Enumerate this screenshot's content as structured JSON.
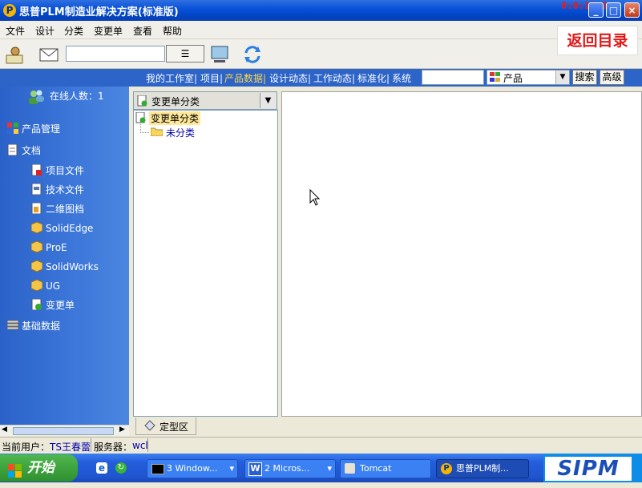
{
  "window": {
    "title": "思普PLM制造业解决方案(标准版)",
    "clock": "0:0:11:0",
    "controls": [
      "_",
      "□",
      "×"
    ]
  },
  "menu": [
    "文件",
    "设计",
    "分类",
    "变更单",
    "查看",
    "帮助"
  ],
  "back_button": "返回目录",
  "nav": {
    "links": [
      "我的工作室|",
      "项目|",
      "产品数据|",
      "设计动态|",
      "工作动态|",
      "标准化|",
      "系统"
    ],
    "search_placeholder": "",
    "select_value": "产品",
    "search_button": "搜索",
    "advanced_button": "高级"
  },
  "sidebar": {
    "online": "在线人数：1",
    "items": [
      {
        "label": "产品管理",
        "icon": "product-icon"
      },
      {
        "label": "文档",
        "icon": "document-icon"
      },
      {
        "label": "项目文件",
        "icon": "project-file-icon"
      },
      {
        "label": "技术文件",
        "icon": "tech-file-icon"
      },
      {
        "label": "二维图档",
        "icon": "drawing-icon"
      },
      {
        "label": "SolidEdge",
        "icon": "cube-icon"
      },
      {
        "label": "ProE",
        "icon": "cube-icon"
      },
      {
        "label": "SolidWorks",
        "icon": "cube-icon"
      },
      {
        "label": "UG",
        "icon": "cube-icon"
      },
      {
        "label": "变更单",
        "icon": "change-order-icon"
      },
      {
        "label": "基础数据",
        "icon": "database-icon"
      }
    ]
  },
  "tree": {
    "dropdown": "变更单分类",
    "root": "变更单分类",
    "child": "未分类"
  },
  "bottom_tab": "定型区",
  "status": {
    "user_label": "当前用户：",
    "user": "TS王春蕾",
    "server_label": "服务器：",
    "server": "wcl"
  },
  "taskbar": {
    "start": "开始",
    "tasks": [
      "3 Window...",
      "2 Micros...",
      "Tomcat",
      "思普PLM制..."
    ],
    "tray": "SIPM"
  },
  "colors": {
    "accent": "#2d64c8",
    "back": "#e01818"
  }
}
